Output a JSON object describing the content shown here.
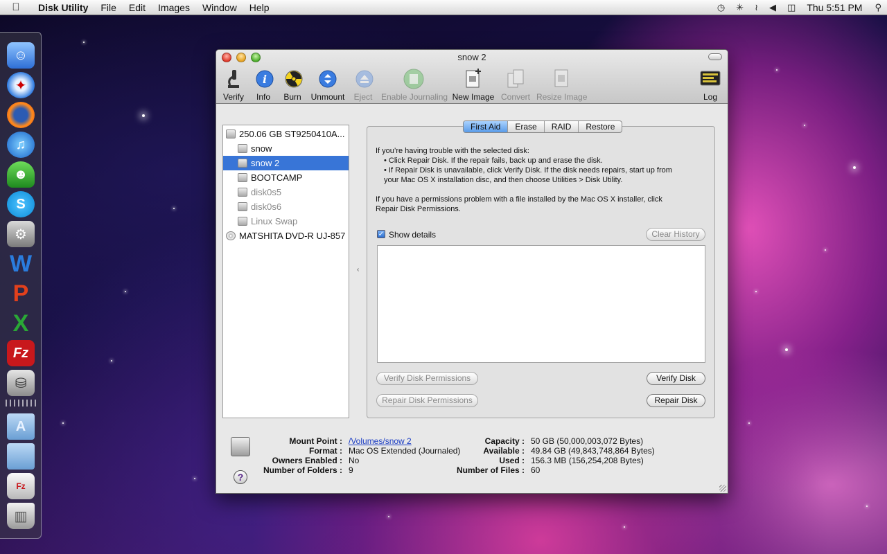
{
  "menubar": {
    "app_name": "Disk Utility",
    "menus": [
      "File",
      "Edit",
      "Images",
      "Window",
      "Help"
    ],
    "clock": "Thu 5:51 PM"
  },
  "window": {
    "title": "snow 2"
  },
  "toolbar": {
    "verify": "Verify",
    "info": "Info",
    "burn": "Burn",
    "unmount": "Unmount",
    "eject": "Eject",
    "enable_journaling": "Enable Journaling",
    "new_image": "New Image",
    "convert": "Convert",
    "resize_image": "Resize Image",
    "log": "Log"
  },
  "sidebar": {
    "items": [
      {
        "label": "250.06 GB ST9250410A..."
      },
      {
        "label": "snow"
      },
      {
        "label": "snow 2"
      },
      {
        "label": "BOOTCAMP"
      },
      {
        "label": "disk0s5"
      },
      {
        "label": "disk0s6"
      },
      {
        "label": "Linux Swap"
      },
      {
        "label": "MATSHITA DVD-R UJ-857"
      }
    ]
  },
  "tabs": [
    "First Aid",
    "Erase",
    "RAID",
    "Restore"
  ],
  "first_aid": {
    "line1": "If you’re having trouble with the selected disk:",
    "line2": "• Click Repair Disk. If the repair fails, back up and erase the disk.",
    "line3": "• If Repair Disk is unavailable, click Verify Disk. If the disk needs repairs, start up from",
    "line4": "your Mac OS X installation disc, and then choose Utilities > Disk Utility.",
    "line5": "If you have a permissions problem with a file installed by the Mac OS X installer, click",
    "line6": "Repair Disk Permissions.",
    "show_details": "Show details",
    "clear_history": "Clear History",
    "verify_permissions": "Verify Disk Permissions",
    "repair_permissions": "Repair Disk Permissions",
    "verify_disk": "Verify Disk",
    "repair_disk": "Repair Disk"
  },
  "disk_info": {
    "mount_point_label": "Mount Point :",
    "mount_point": "/Volumes/snow 2",
    "format_label": "Format :",
    "format": "Mac OS Extended (Journaled)",
    "owners_label": "Owners Enabled :",
    "owners": "No",
    "folders_label": "Number of Folders :",
    "folders": "9",
    "capacity_label": "Capacity :",
    "capacity": "50 GB (50,000,003,072 Bytes)",
    "available_label": "Available :",
    "available": "49.84 GB (49,843,748,864 Bytes)",
    "used_label": "Used :",
    "used": "156.3 MB (156,254,208 Bytes)",
    "files_label": "Number of Files :",
    "files": "60"
  },
  "help": "?"
}
